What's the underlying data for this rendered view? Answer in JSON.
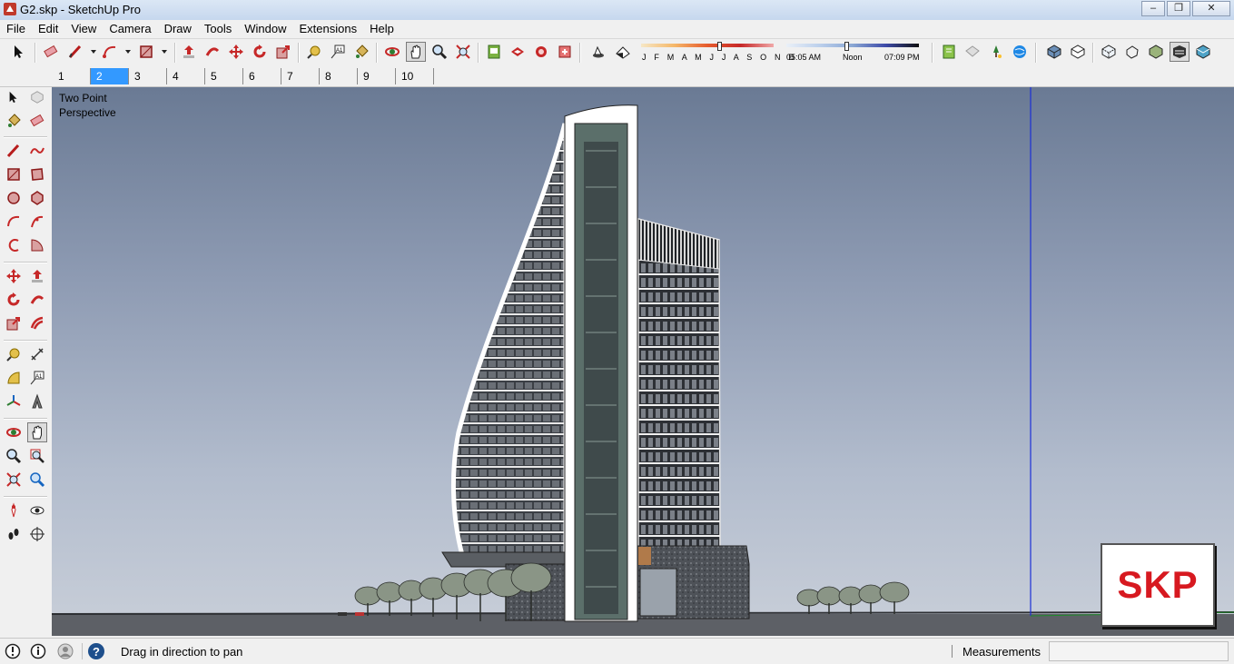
{
  "window": {
    "title": "G2.skp - SketchUp Pro",
    "minimize": "–",
    "restore": "❐",
    "close": "✕"
  },
  "menu": [
    "File",
    "Edit",
    "View",
    "Camera",
    "Draw",
    "Tools",
    "Window",
    "Extensions",
    "Help"
  ],
  "shadow_settings": {
    "months": "J F M A M J J A S O N D",
    "time_start": "05:05 AM",
    "time_noon": "Noon",
    "time_end": "07:09 PM"
  },
  "scenes": [
    "1",
    "2",
    "3",
    "4",
    "5",
    "6",
    "7",
    "8",
    "9",
    "10"
  ],
  "active_scene": "2",
  "viewport": {
    "camera_line1": "Two Point",
    "camera_line2": "Perspective",
    "watermark": "SKP"
  },
  "status": {
    "hint": "Drag in direction to pan",
    "measurements_label": "Measurements",
    "measurements_value": ""
  },
  "colors": {
    "accent": "#3399ff",
    "watermark": "#d71920",
    "sky_top": "#6a7a94",
    "sky_bottom": "#c9cfd9"
  }
}
